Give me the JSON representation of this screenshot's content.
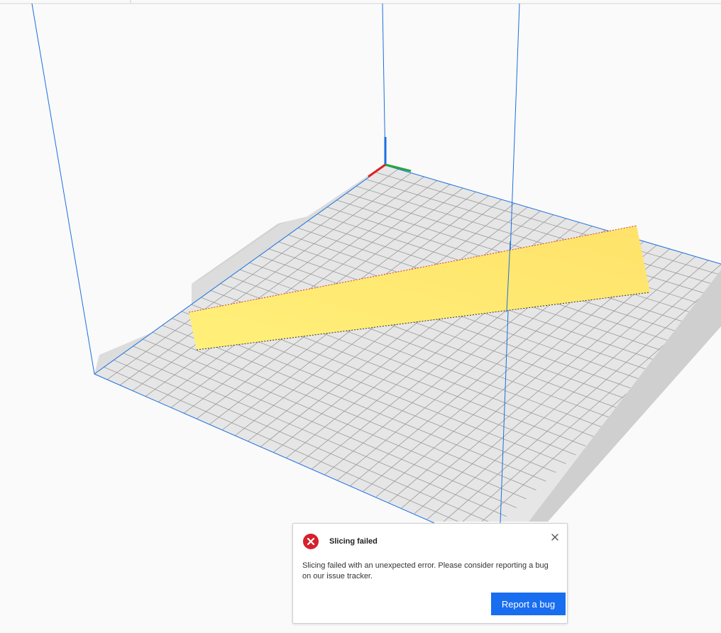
{
  "viewport": {
    "plate_color": "#e6e6e6",
    "grid_color": "#9a9a9a",
    "frame_color": "#1b6fe0",
    "model_color": "#ffe96b",
    "axis_colors": {
      "x": "#e02020",
      "y": "#26a640",
      "z": "#1b6fe0"
    }
  },
  "notification": {
    "title": "Slicing failed",
    "message": "Slicing failed with an unexpected error. Please consider reporting a bug on our issue tracker.",
    "action_label": "Report a bug",
    "icon": "error-icon",
    "close_icon": "close-icon",
    "accent_color": "#196ef0",
    "error_color": "#d6202c"
  }
}
